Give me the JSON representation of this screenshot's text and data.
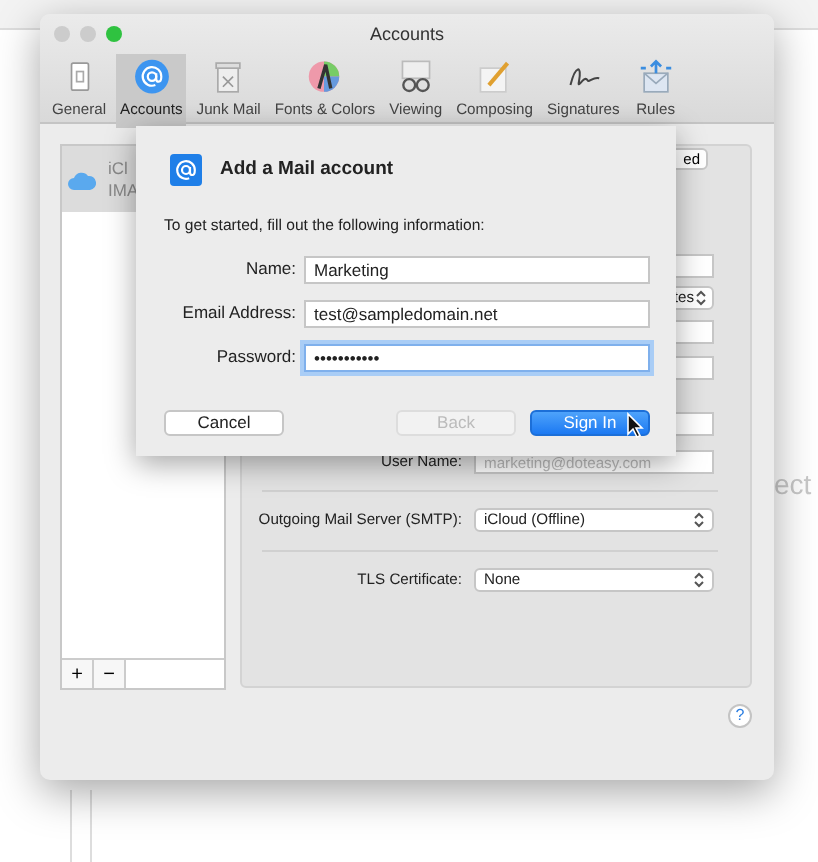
{
  "window": {
    "title": "Accounts"
  },
  "toolbar": [
    {
      "label": "General",
      "selected": false
    },
    {
      "label": "Accounts",
      "selected": true
    },
    {
      "label": "Junk Mail",
      "selected": false
    },
    {
      "label": "Fonts & Colors",
      "selected": false
    },
    {
      "label": "Viewing",
      "selected": false
    },
    {
      "label": "Composing",
      "selected": false
    },
    {
      "label": "Signatures",
      "selected": false
    },
    {
      "label": "Rules",
      "selected": false
    }
  ],
  "account_list": {
    "items": [
      {
        "line_1": "iCl",
        "line_2": "IMA",
        "selected": true
      }
    ],
    "add_button": "+",
    "remove_button": "−"
  },
  "account_panel": {
    "rows": [
      {
        "kind": "button",
        "text": "ed"
      },
      {
        "kind": "field"
      },
      {
        "kind": "popup",
        "value": "tes"
      },
      {
        "kind": "field"
      },
      {
        "kind": "field"
      },
      {
        "kind": "field"
      },
      {
        "kind": "field",
        "label": "User Name:",
        "placeholder": "marketing@doteasy.com"
      },
      {
        "kind": "divider"
      },
      {
        "kind": "popup",
        "label": "Outgoing Mail Server (SMTP):",
        "value": "iCloud (Offline)"
      },
      {
        "kind": "divider"
      },
      {
        "kind": "popup",
        "label": "TLS Certificate:",
        "value": "None"
      }
    ]
  },
  "help_button": "?",
  "background_text": "ect",
  "sheet": {
    "title": "Add a Mail account",
    "instruction": "To get started, fill out the following information:",
    "fields": [
      {
        "label": "Name:",
        "value": "Marketing",
        "focused": false
      },
      {
        "label": "Email Address:",
        "value": "test@sampledomain.net",
        "focused": false
      },
      {
        "label": "Password:",
        "value": "•••••••••••",
        "focused": true
      }
    ],
    "buttons": [
      {
        "label": "Cancel",
        "kind": "default",
        "disabled": false
      },
      {
        "label": "Back",
        "kind": "default",
        "disabled": true
      },
      {
        "label": "Sign In",
        "kind": "primary",
        "disabled": false
      }
    ]
  }
}
